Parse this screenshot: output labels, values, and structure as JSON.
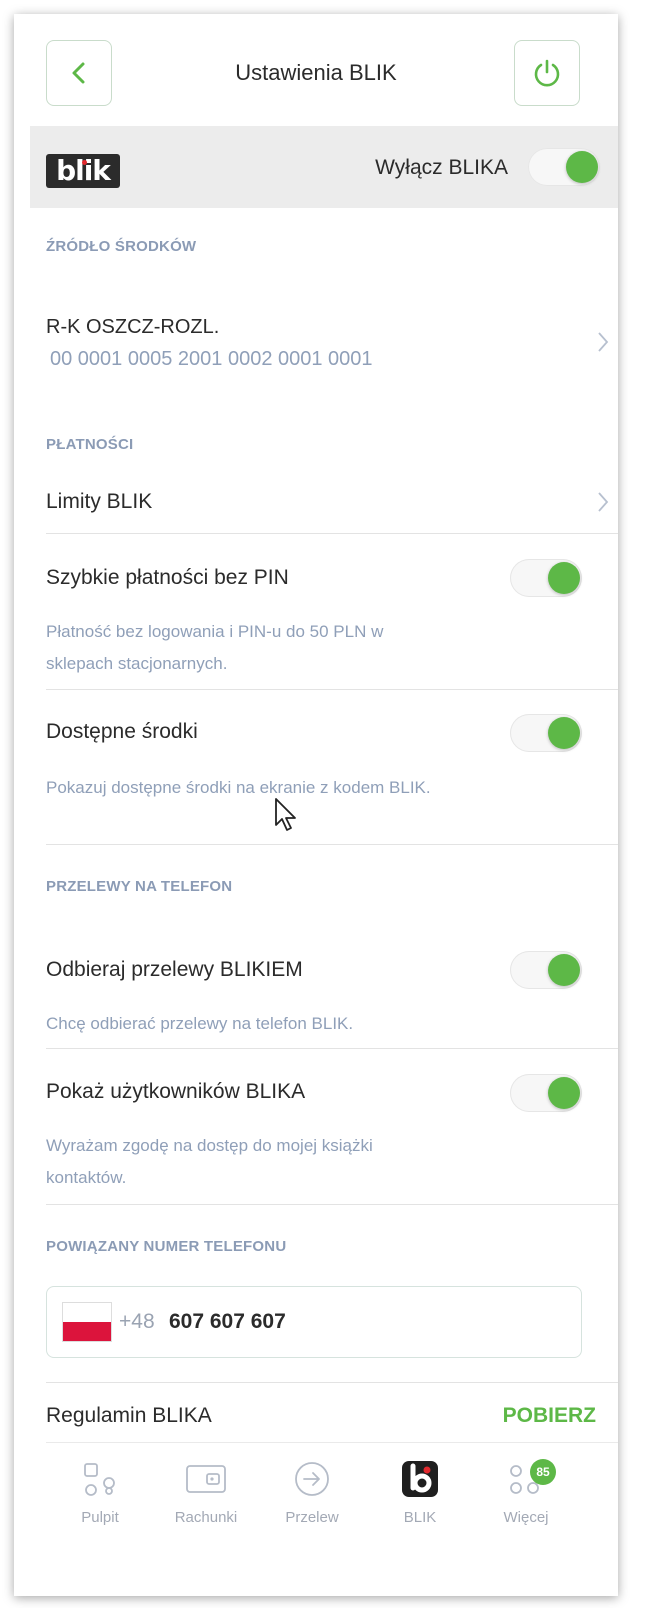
{
  "header": {
    "title": "Ustawienia BLIK"
  },
  "blik_bar": {
    "logo_text": "blik",
    "toggle_label": "Wyłącz BLIKA",
    "enabled": true
  },
  "funds_source": {
    "section_title": "ŹRÓDŁO ŚRODKÓW",
    "account_name": "R-K OSZCZ-ROZL.",
    "account_number": "00 0001 0005 2001 0002 0001 0001"
  },
  "payments": {
    "section_title": "PŁATNOŚCI",
    "limits_label": "Limity BLIK",
    "fast_payments": {
      "label": "Szybkie płatności bez PIN",
      "description": "Płatność bez logowania i PIN-u do 50 PLN w sklepach stacjonarnych.",
      "enabled": true
    },
    "available_funds": {
      "label": "Dostępne środki",
      "description": "Pokazuj dostępne środki na ekranie z kodem BLIK.",
      "enabled": true
    }
  },
  "phone_transfers": {
    "section_title": "PRZELEWY NA TELEFON",
    "receive": {
      "label": "Odbieraj przelewy BLIKIEM",
      "description": "Chcę odbierać przelewy na telefon BLIK.",
      "enabled": true
    },
    "show_users": {
      "label": "Pokaż użytkowników BLIKA",
      "description": "Wyrażam zgodę na dostęp do mojej książki kontaktów.",
      "enabled": true
    }
  },
  "linked_phone": {
    "section_title": "POWIĄZANY NUMER TELEFONU",
    "prefix": "+48",
    "number": "607 607 607"
  },
  "regulations": {
    "label": "Regulamin BLIKA",
    "action": "POBIERZ"
  },
  "bottom_nav": {
    "items": [
      {
        "label": "Pulpit",
        "icon": "dashboard-icon"
      },
      {
        "label": "Rachunki",
        "icon": "wallet-icon"
      },
      {
        "label": "Przelew",
        "icon": "transfer-arrow-icon"
      },
      {
        "label": "BLIK",
        "icon": "blik-icon"
      },
      {
        "label": "Więcej",
        "icon": "more-icon",
        "badge": "85"
      }
    ]
  },
  "colors": {
    "accent_green": "#5db847",
    "muted_blue": "#8b9bb5",
    "text_dark": "#2b2b2b"
  }
}
